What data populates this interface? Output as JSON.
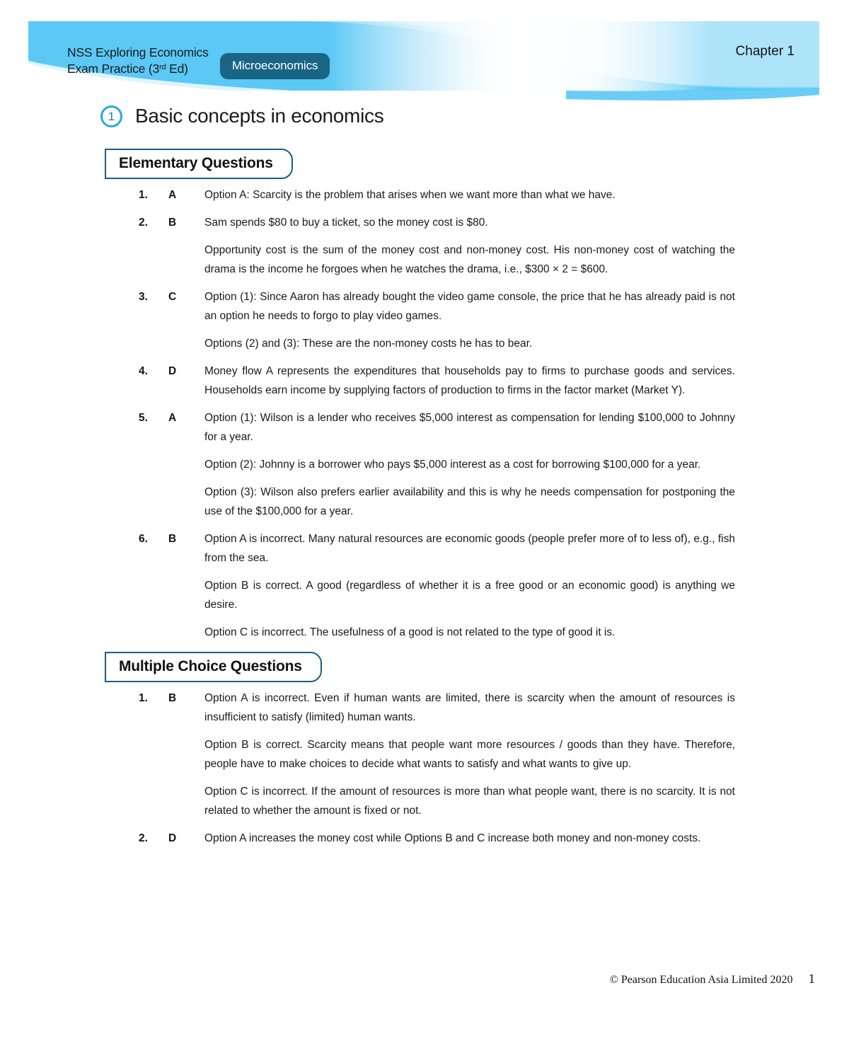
{
  "header": {
    "publication_line1": "NSS Exploring Economics",
    "publication_line2_pre": "Exam Practice (3",
    "publication_line2_sup": "rd",
    "publication_line2_post": " Ed)",
    "subject_badge": "Microeconomics",
    "chapter_label": "Chapter 1",
    "banner_color": "#5bc8f5",
    "badge_color": "#1a6485"
  },
  "chapter": {
    "number": "1",
    "title": "Basic concepts in economics",
    "circle_color": "#29a9e0"
  },
  "sections": [
    {
      "heading": "Elementary Questions",
      "items": [
        {
          "number": "1.",
          "answer": "A",
          "paragraphs": [
            "Option A: Scarcity is the problem that arises when we want more than what we have."
          ]
        },
        {
          "number": "2.",
          "answer": "B",
          "paragraphs": [
            "Sam spends $80 to buy a ticket, so the money cost is $80.",
            "Opportunity cost is the sum of the money cost and non-money cost. His non-money cost of watching the drama is the income he forgoes when he watches the drama, i.e., $300 × 2 = $600."
          ]
        },
        {
          "number": "3.",
          "answer": "C",
          "paragraphs": [
            "Option (1): Since Aaron has already bought the video game console, the price that he has already paid is not an option he needs to forgo to play video games.",
            "Options (2) and (3): These are the non-money costs he has to bear."
          ]
        },
        {
          "number": "4.",
          "answer": "D",
          "paragraphs": [
            "Money flow A represents the expenditures that households pay to firms to purchase goods and services. Households earn income by supplying factors of production to firms in the factor market (Market Y)."
          ]
        },
        {
          "number": "5.",
          "answer": "A",
          "paragraphs": [
            "Option (1): Wilson is a lender who receives $5,000 interest as compensation for lending $100,000 to Johnny for a year.",
            "Option (2): Johnny is a borrower who pays $5,000 interest as a cost for borrowing $100,000 for a year.",
            "Option (3): Wilson also prefers earlier availability and this is why he needs compensation for postponing the use of the $100,000 for a year."
          ]
        },
        {
          "number": "6.",
          "answer": "B",
          "paragraphs": [
            "Option A is incorrect. Many natural resources are economic goods (people prefer more of to less of), e.g., fish from the sea.",
            "Option B is correct. A good (regardless of whether it is a free good or an economic good) is anything we desire.",
            "Option C is incorrect. The usefulness of a good is not related to the type of good it is."
          ]
        }
      ]
    },
    {
      "heading": "Multiple Choice Questions",
      "items": [
        {
          "number": "1.",
          "answer": "B",
          "paragraphs": [
            "Option A is incorrect. Even if human wants are limited, there is scarcity when the amount of resources is insufficient to satisfy (limited) human wants.",
            "Option B is correct. Scarcity means that people want more resources / goods than they have. Therefore, people have to make choices to decide what wants to satisfy and what wants to give up.",
            "Option C is incorrect. If the amount of resources is more than what people want, there is no scarcity. It is not related to whether the amount is fixed or not."
          ]
        },
        {
          "number": "2.",
          "answer": "D",
          "paragraphs": [
            "Option A increases the money cost while Options B and C increase both money and non-money costs."
          ]
        }
      ]
    }
  ],
  "footer": {
    "copyright": "© Pearson Education Asia Limited 2020",
    "page_number": "1"
  }
}
